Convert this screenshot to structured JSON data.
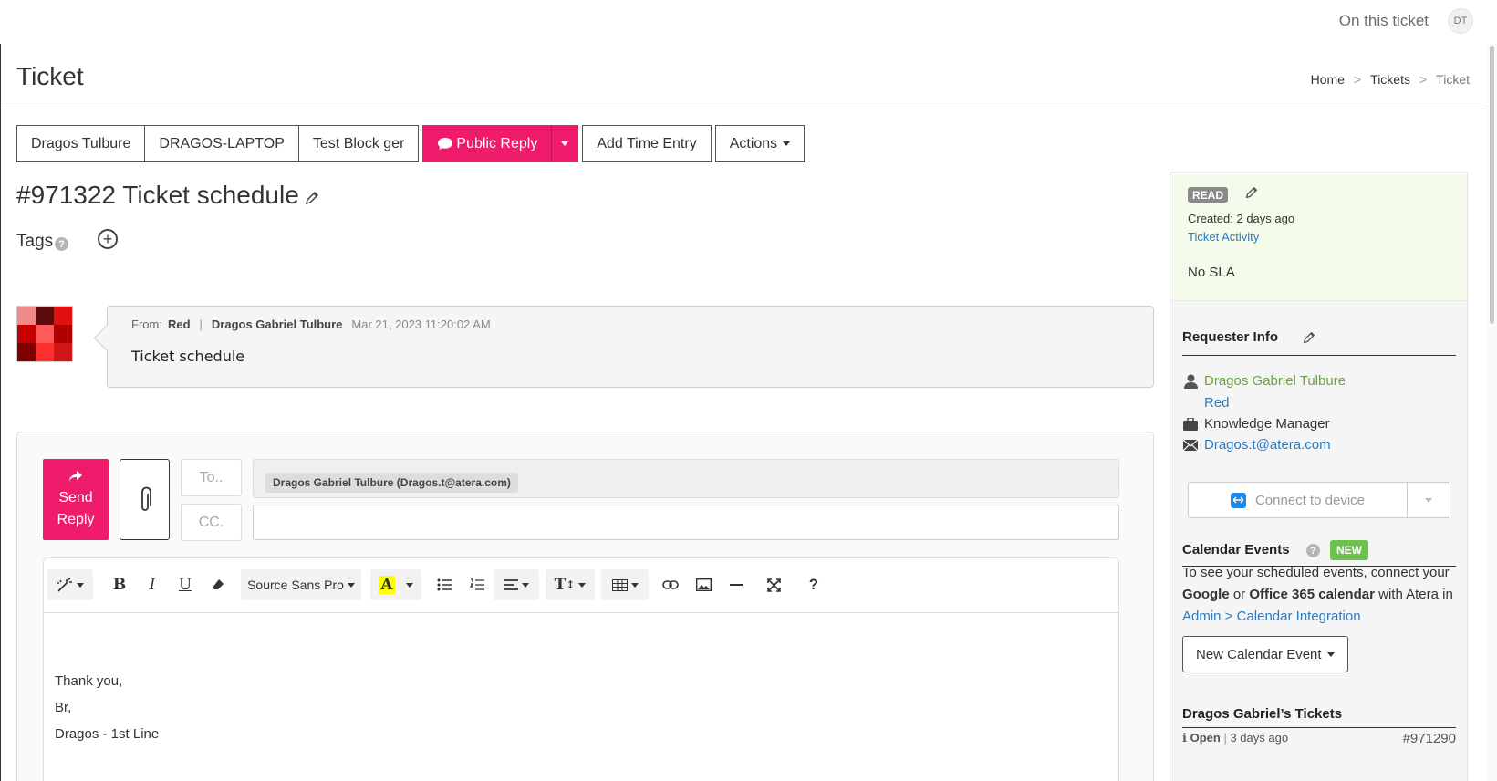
{
  "topbar": {
    "on_ticket": "On this ticket",
    "user_initials": "DT"
  },
  "page": {
    "title": "Ticket"
  },
  "breadcrumb": {
    "home": "Home",
    "tickets": "Tickets",
    "current": "Ticket",
    "separator": ">"
  },
  "toolbar": {
    "customer": "Dragos Tulbure",
    "device": "DRAGOS-LAPTOP",
    "folder": "Test Block ger",
    "public_reply": "Public Reply",
    "add_time_entry": "Add Time Entry",
    "actions": "Actions"
  },
  "ticket": {
    "title": "#971322 Ticket schedule",
    "tags_label": "Tags"
  },
  "message": {
    "from_label": "From:",
    "from_company": "Red",
    "from_name": "Dragos Gabriel Tulbure",
    "date": "Mar 21, 2023 11:20:02 AM",
    "body": "Ticket schedule"
  },
  "reply": {
    "send_label_1": "Send",
    "send_label_2": "Reply",
    "to_label": "To..",
    "cc_label": "CC.",
    "recipient": "Dragos Gabriel Tulbure (Dragos.t@atera.com)",
    "font_name": "Source Sans Pro",
    "body_lines": [
      "Thank you,",
      "Br,",
      "Dragos - 1st Line"
    ]
  },
  "side": {
    "status_badge": "READ",
    "created": "Created: 2 days ago",
    "activity_link": "Ticket Activity",
    "sla": "No SLA",
    "requester_title": "Requester Info",
    "requester_name": "Dragos Gabriel Tulbure",
    "requester_company": "Red",
    "requester_role": "Knowledge Manager",
    "requester_email": "Dragos.t@atera.com",
    "connect_label": "Connect to device",
    "calendar_title": "Calendar Events",
    "new_badge": "NEW",
    "cal_text_1": "To see your scheduled events, connect your ",
    "cal_google": "Google",
    "cal_or": " or ",
    "cal_office": "Office 365 calendar",
    "cal_text_2": " with Atera in ",
    "cal_link": "Admin > Calendar Integration",
    "new_event": "New Calendar Event",
    "tickets_title": "Dragos Gabriel’s Tickets",
    "ticket_status": "Open",
    "ticket_age": "3 days ago",
    "ticket_number": "#971290"
  },
  "colors": {
    "accent": "#ef1c6c",
    "link": "#2a7bc0",
    "green": "#6aa33f",
    "new_badge": "#6cc24a"
  },
  "icons": [
    "pencil-icon",
    "help-icon",
    "plus-circle-icon",
    "comment-icon",
    "share-icon",
    "paperclip-icon",
    "magic-icon",
    "bold-icon",
    "italic-icon",
    "underline-icon",
    "eraser-icon",
    "highlight-icon",
    "bullet-list-icon",
    "number-list-icon",
    "align-icon",
    "text-size-icon",
    "table-icon",
    "link-icon",
    "image-icon",
    "hr-icon",
    "fullscreen-icon",
    "question-icon",
    "user-icon",
    "briefcase-icon",
    "envelope-icon",
    "teamviewer-icon",
    "info-icon"
  ]
}
